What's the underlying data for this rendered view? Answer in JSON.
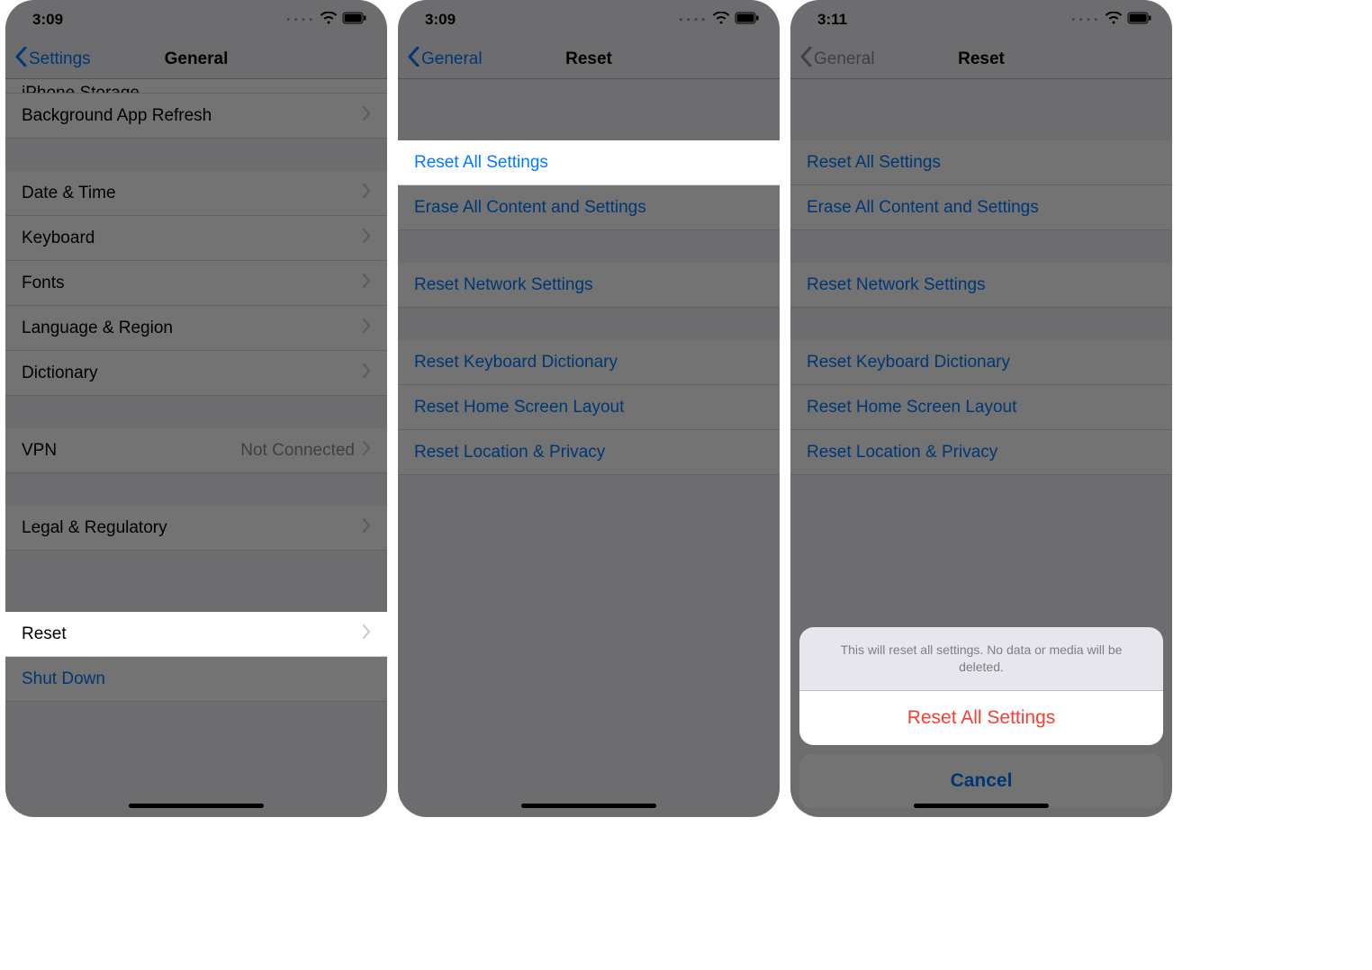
{
  "panels": [
    {
      "status": {
        "time": "3:09"
      },
      "nav": {
        "back": "Settings",
        "title": "General",
        "back_enabled": true
      },
      "rows": [
        {
          "kind": "cut",
          "label": "iPhone Storage"
        },
        {
          "kind": "cell",
          "label": "Background App Refresh",
          "chevron": true
        },
        {
          "kind": "gap"
        },
        {
          "kind": "cell",
          "label": "Date & Time",
          "chevron": true
        },
        {
          "kind": "cell",
          "label": "Keyboard",
          "chevron": true
        },
        {
          "kind": "cell",
          "label": "Fonts",
          "chevron": true
        },
        {
          "kind": "cell",
          "label": "Language & Region",
          "chevron": true
        },
        {
          "kind": "cell",
          "label": "Dictionary",
          "chevron": true
        },
        {
          "kind": "gap"
        },
        {
          "kind": "cell",
          "label": "VPN",
          "detail": "Not Connected",
          "chevron": true
        },
        {
          "kind": "gap"
        },
        {
          "kind": "cell",
          "label": "Legal & Regulatory",
          "chevron": true
        },
        {
          "kind": "gap-lg"
        },
        {
          "kind": "cell",
          "label": "Reset",
          "chevron": true,
          "highlight": true
        },
        {
          "kind": "link",
          "label": "Shut Down"
        }
      ]
    },
    {
      "status": {
        "time": "3:09"
      },
      "nav": {
        "back": "General",
        "title": "Reset",
        "back_enabled": true
      },
      "rows": [
        {
          "kind": "gap-lg"
        },
        {
          "kind": "link",
          "label": "Reset All Settings",
          "highlight": true
        },
        {
          "kind": "link",
          "label": "Erase All Content and Settings"
        },
        {
          "kind": "gap"
        },
        {
          "kind": "link",
          "label": "Reset Network Settings"
        },
        {
          "kind": "gap"
        },
        {
          "kind": "link",
          "label": "Reset Keyboard Dictionary"
        },
        {
          "kind": "link",
          "label": "Reset Home Screen Layout"
        },
        {
          "kind": "link",
          "label": "Reset Location & Privacy"
        }
      ]
    },
    {
      "status": {
        "time": "3:11"
      },
      "nav": {
        "back": "General",
        "title": "Reset",
        "back_enabled": false
      },
      "rows": [
        {
          "kind": "gap-lg"
        },
        {
          "kind": "link",
          "label": "Reset All Settings"
        },
        {
          "kind": "link",
          "label": "Erase All Content and Settings"
        },
        {
          "kind": "gap"
        },
        {
          "kind": "link",
          "label": "Reset Network Settings"
        },
        {
          "kind": "gap"
        },
        {
          "kind": "link",
          "label": "Reset Keyboard Dictionary"
        },
        {
          "kind": "link",
          "label": "Reset Home Screen Layout"
        },
        {
          "kind": "link",
          "label": "Reset Location & Privacy"
        }
      ],
      "sheet": {
        "message": "This will reset all settings. No data or media will be deleted.",
        "destructive": "Reset All Settings",
        "cancel": "Cancel"
      }
    }
  ]
}
